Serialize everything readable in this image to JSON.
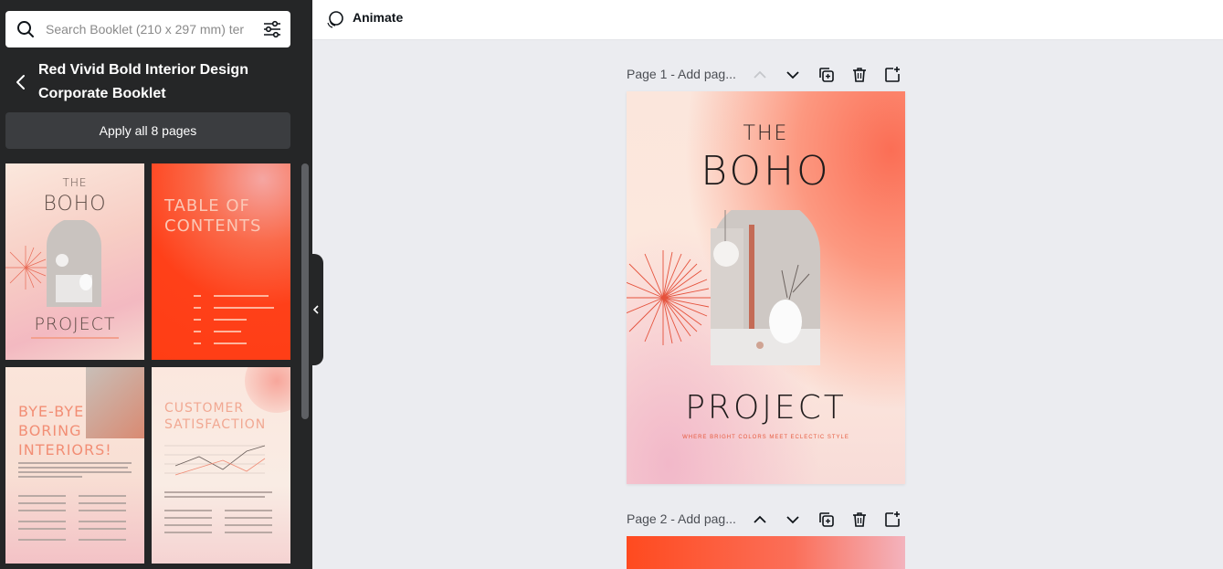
{
  "sidebar": {
    "search_placeholder": "Search Booklet (210 x 297 mm) ter",
    "template_title": "Red Vivid Bold Interior Design Corporate Booklet",
    "apply_label": "Apply all 8 pages",
    "thumbs": {
      "t1": {
        "the": "THE",
        "boho": "BOHO",
        "project": "PROJECT"
      },
      "t2": {
        "title": "TABLE OF CONTENTS"
      },
      "t3": {
        "title": "BYE-BYE BORING INTERIORS!"
      },
      "t4": {
        "title": "CUSTOMER SATISFACTION"
      }
    }
  },
  "topbar": {
    "animate_label": "Animate"
  },
  "pages": [
    {
      "label": "Page 1 - Add pag..."
    },
    {
      "label": "Page 2 - Add pag..."
    }
  ],
  "page1": {
    "the": "THE",
    "boho": "BOHO",
    "project": "PROJECT",
    "subtitle": "WHERE BRIGHT COLORS MEET ECLECTIC STYLE"
  },
  "colors": {
    "sidebar": "#252627",
    "accent_orange": "#ff4019",
    "canvas": "#ebecf0"
  }
}
